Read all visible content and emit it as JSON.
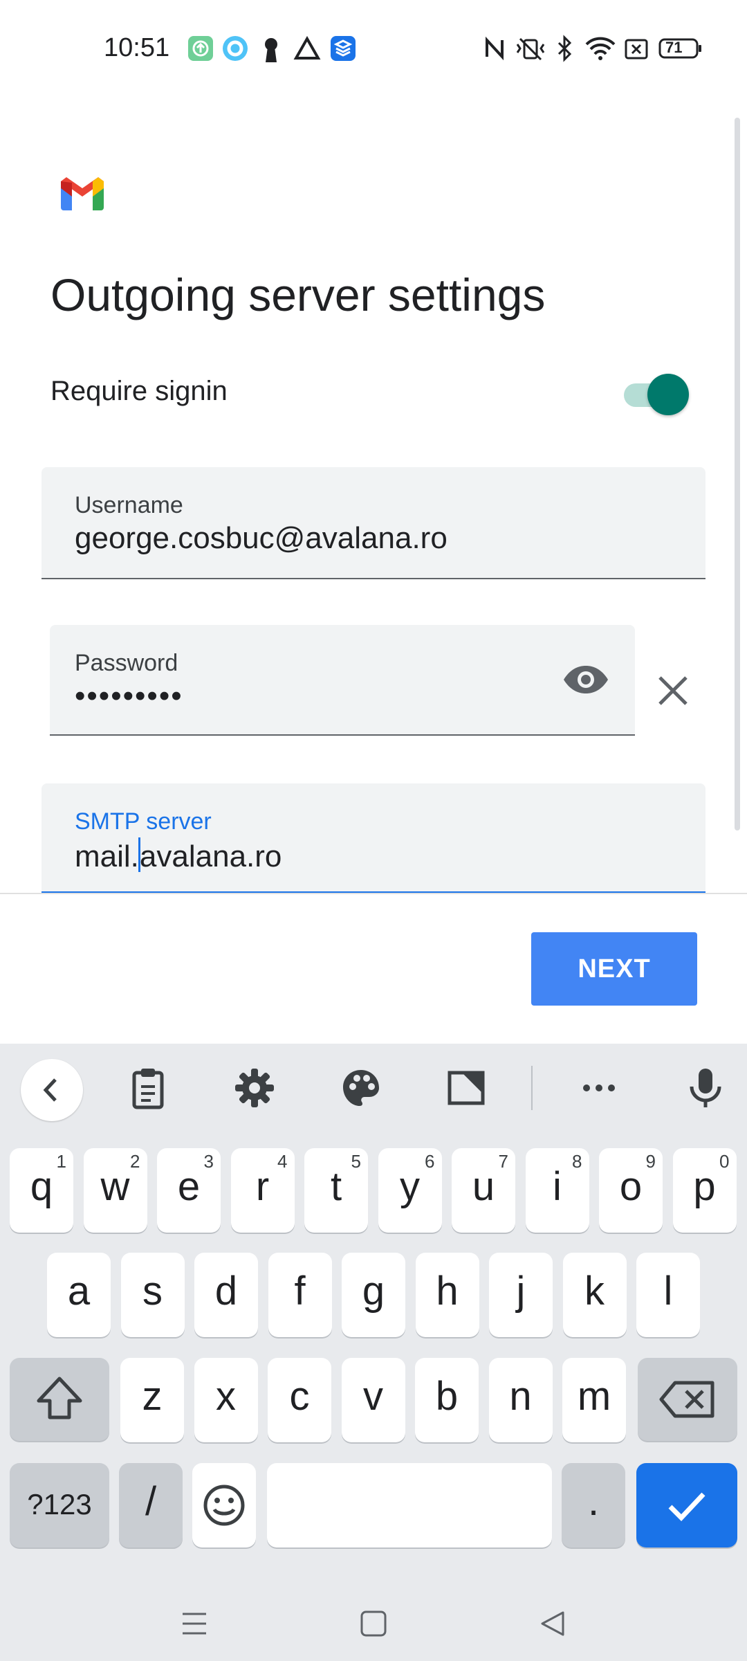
{
  "status_bar": {
    "time": "10:51",
    "battery": "71",
    "left_icons": [
      "upload-icon",
      "circle-app-icon",
      "keyhole-icon",
      "drive-icon",
      "stack-app-icon"
    ],
    "right_icons": [
      "nfc-icon",
      "vibrate-icon",
      "bluetooth-icon",
      "wifi-icon",
      "no-sim-icon",
      "battery-icon"
    ]
  },
  "header": {
    "logo": "gmail-logo",
    "title": "Outgoing server settings"
  },
  "require_signin": {
    "label": "Require signin",
    "enabled": true
  },
  "fields": {
    "username": {
      "label": "Username",
      "value": "george.cosbuc@avalana.ro"
    },
    "password": {
      "label": "Password",
      "value": "•••••••••"
    },
    "smtp": {
      "label": "SMTP server",
      "value_before_caret": "mail.",
      "value_after_caret": "avalana.ro"
    }
  },
  "next_label": "NEXT",
  "colors": {
    "accent": "#1a73e8",
    "next_button": "#4285f4",
    "toggle_on": "#00796b"
  },
  "keyboard": {
    "toolbar_icons": [
      "back-arrow-icon",
      "clipboard-icon",
      "settings-icon",
      "palette-icon",
      "resize-icon",
      "more-icon",
      "mic-icon"
    ],
    "row1": [
      {
        "k": "q",
        "h": "1"
      },
      {
        "k": "w",
        "h": "2"
      },
      {
        "k": "e",
        "h": "3"
      },
      {
        "k": "r",
        "h": "4"
      },
      {
        "k": "t",
        "h": "5"
      },
      {
        "k": "y",
        "h": "6"
      },
      {
        "k": "u",
        "h": "7"
      },
      {
        "k": "i",
        "h": "8"
      },
      {
        "k": "o",
        "h": "9"
      },
      {
        "k": "p",
        "h": "0"
      }
    ],
    "row2": [
      "a",
      "s",
      "d",
      "f",
      "g",
      "h",
      "j",
      "k",
      "l"
    ],
    "row3": [
      "z",
      "x",
      "c",
      "v",
      "b",
      "n",
      "m"
    ],
    "symbols_key": "?123",
    "slash_key": "/",
    "period_key": "."
  }
}
